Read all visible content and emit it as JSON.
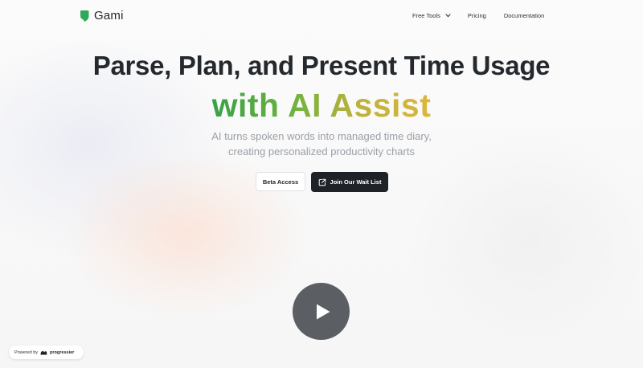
{
  "brand": {
    "name": "Gami",
    "icon": "gami-logo-icon",
    "color": "#2fa85a"
  },
  "nav": {
    "free_tools": "Free Tools",
    "pricing": "Pricing",
    "documentation": "Documentation"
  },
  "hero": {
    "title": "Parse, Plan, and Present Time Usage",
    "accent": "with AI Assist",
    "subtitle_line1": "AI turns spoken words into managed time diary,",
    "subtitle_line2": "creating personalized productivity charts",
    "accent_gradient": [
      "#3aa047",
      "#6ab23f",
      "#b9b23c",
      "#ddb63d"
    ]
  },
  "buttons": {
    "beta": "Beta Access",
    "waitlist": "Join Our Wait List",
    "waitlist_icon": "external-link-icon"
  },
  "video": {
    "icon": "play-icon"
  },
  "badge": {
    "prefix": "Powered by",
    "name": "progressier",
    "icon": "progressier-logo-icon"
  }
}
